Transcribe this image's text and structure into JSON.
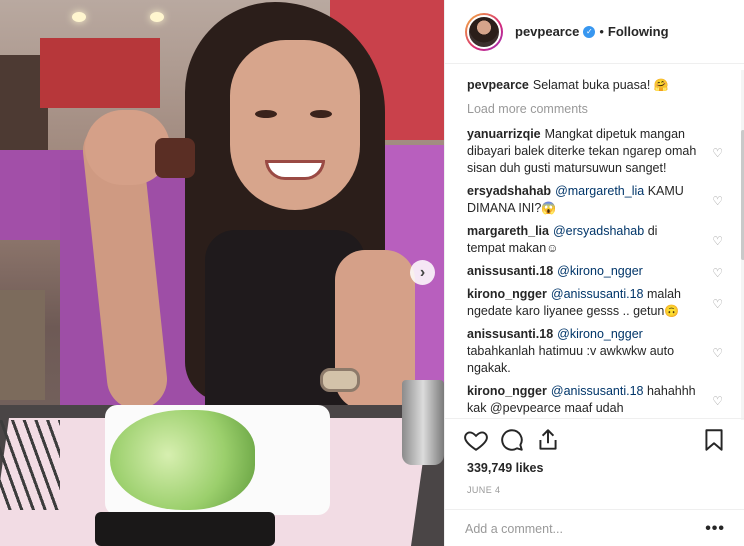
{
  "post": {
    "username": "pevpearce",
    "follow_status": "Following",
    "separator": "•",
    "next_icon": "chevron-right-icon"
  },
  "caption": {
    "username": "pevpearce",
    "text": "Selamat buka puasa!",
    "emoji": "🤗"
  },
  "load_more": "Load more comments",
  "comments": [
    {
      "username": "yanuarrizqie",
      "mention": "",
      "text": "Mangkat dipetuk mangan dibayari balek diterke tekan ngarep omah sisan duh gusti matursuwun sanget!",
      "emoji": ""
    },
    {
      "username": "ersyadshahab",
      "mention": "@margareth_lia",
      "text": "KAMU DIMANA INI?",
      "emoji": "😱"
    },
    {
      "username": "margareth_lia",
      "mention": "@ersyadshahab",
      "text": "di tempat makan",
      "emoji": "☺"
    },
    {
      "username": "anissusanti.18",
      "mention": "@kirono_ngger",
      "text": "",
      "emoji": ""
    },
    {
      "username": "kirono_ngger",
      "mention": "@anissusanti.18",
      "text": "malah ngedate karo liyanee gesss .. getun",
      "emoji": "🙃"
    },
    {
      "username": "anissusanti.18",
      "mention": "@kirono_ngger",
      "text": "tabahkanlah hatimuu :v awkwkw auto ngakak.",
      "emoji": ""
    },
    {
      "username": "kirono_ngger",
      "mention": "@anissusanti.18",
      "text": "hahahhh kak @pevpearce maaf udah",
      "emoji": ""
    }
  ],
  "actions": {
    "like_icon": "heart-icon",
    "comment_icon": "comment-icon",
    "share_icon": "share-icon",
    "save_icon": "bookmark-icon",
    "likes": "339,749 likes",
    "date": "JUNE 4",
    "add_comment_placeholder": "Add a comment...",
    "more": "•••"
  },
  "colors": {
    "verified": "#3897f0",
    "mention": "#003569",
    "muted": "#999999",
    "text": "#262626"
  }
}
